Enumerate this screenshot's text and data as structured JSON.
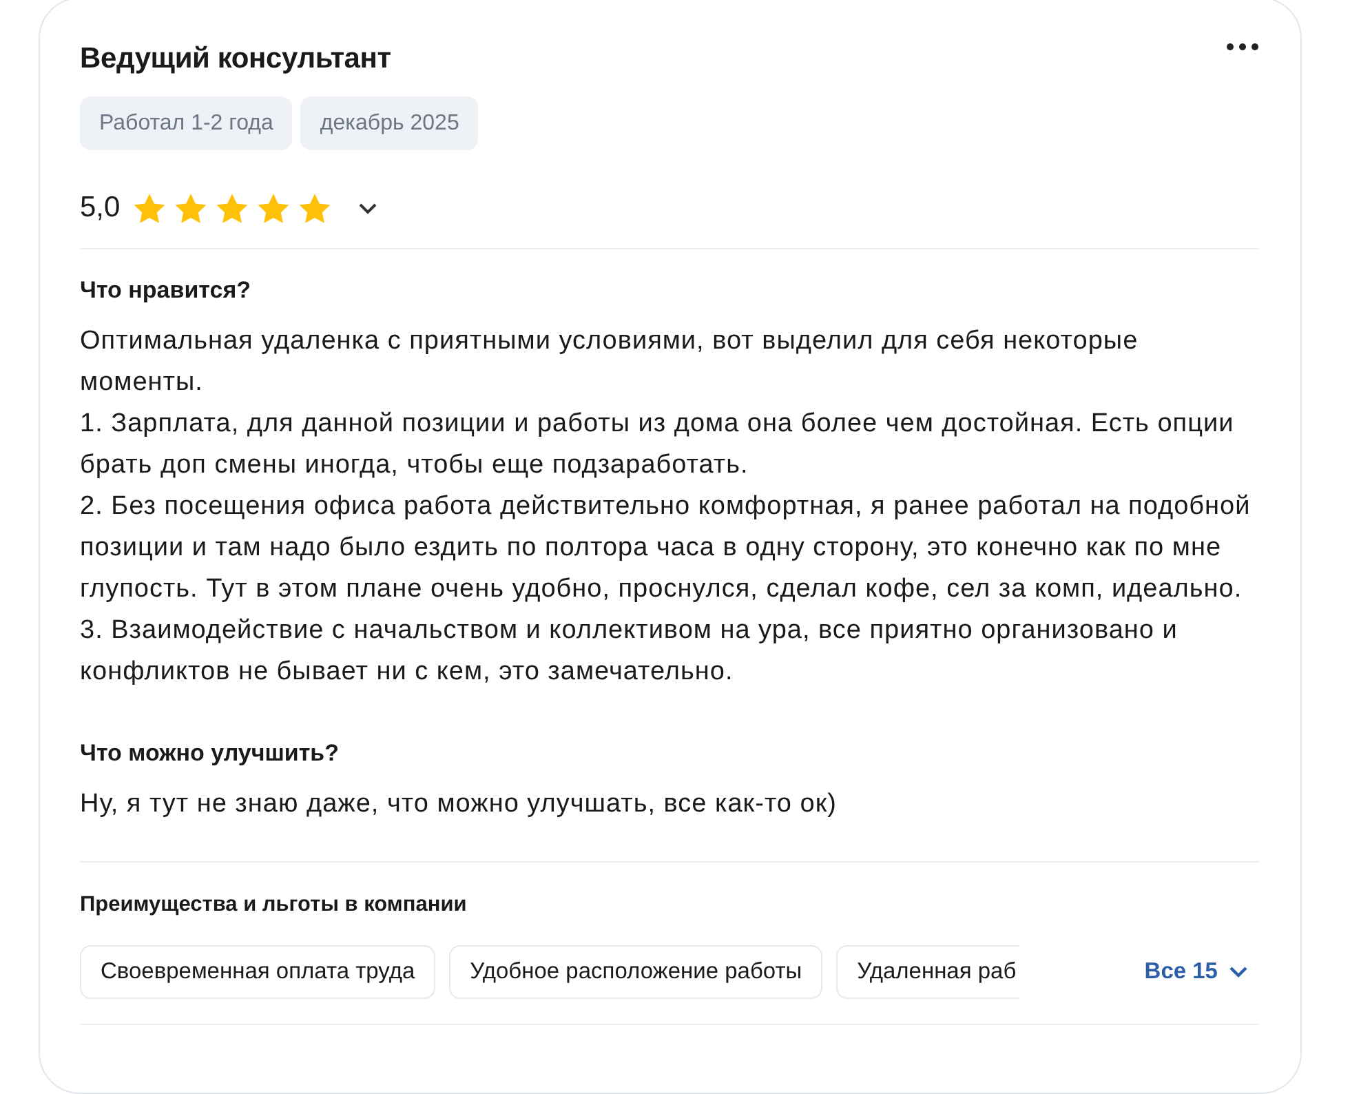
{
  "review": {
    "title": "Ведущий консультант",
    "tags": [
      "Работал 1-2 года",
      "декабрь 2025"
    ],
    "rating": {
      "value": "5,0",
      "stars": 5
    },
    "sections": [
      {
        "heading": "Что нравится?",
        "text": "Оптимальная удаленка с приятными условиями, вот выделил для себя некоторые моменты.\n1. Зарплата, для данной позиции и работы из дома она более чем достойная. Есть опции брать доп смены иногда, чтобы еще подзаработать.\n2. Без посещения офиса работа действительно комфортная, я ранее работал на подобной позиции и там надо было ездить по полтора часа в одну сторону, это конечно как по мне глупость. Тут в этом плане очень удобно, проснулся, сделал кофе, сел за комп, идеально.\n3. Взаимодействие с начальством и коллективом на ура, все приятно организовано и конфликтов не бывает ни с кем, это замечательно."
      },
      {
        "heading": "Что можно улучшить?",
        "text": "Ну, я тут не знаю даже, что можно улучшать, все как-то ок)"
      }
    ],
    "benefits": {
      "heading": "Преимущества и льготы в компании",
      "items": [
        "Своевременная оплата труда",
        "Удобное расположение работы",
        "Удаленная раб"
      ],
      "more": "Все 15"
    }
  }
}
